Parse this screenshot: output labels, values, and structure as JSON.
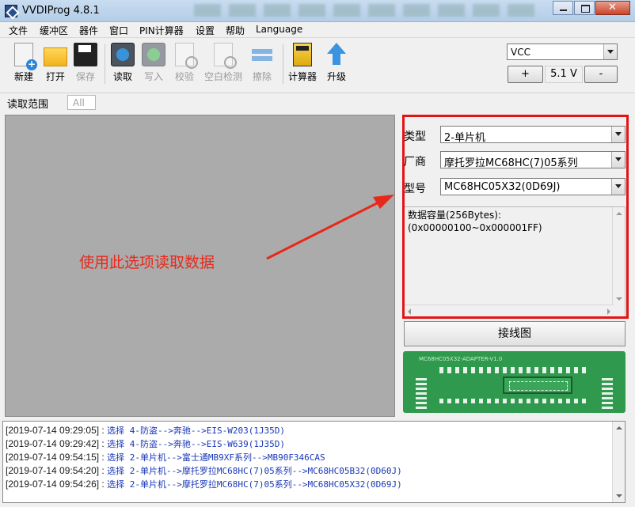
{
  "window": {
    "title": "VVDIProg 4.8.1"
  },
  "menu": [
    "文件",
    "缓冲区",
    "器件",
    "窗口",
    "PIN计算器",
    "设置",
    "帮助",
    "Language"
  ],
  "toolbar": {
    "new": "新建",
    "open": "打开",
    "save": "保存",
    "read": "读取",
    "write": "写入",
    "verify": "校验",
    "blank_check": "空白检测",
    "erase": "擦除",
    "calculator": "计算器",
    "upgrade": "升级"
  },
  "vcc": {
    "selected": "VCC",
    "plus": "+",
    "value": "5.1 V",
    "minus": "-"
  },
  "range": {
    "label": "读取范围",
    "value": "All"
  },
  "annotation": "使用此选项读取数据",
  "device": {
    "type_label": "类型",
    "type_value": "2-单片机",
    "vendor_label": "厂商",
    "vendor_value": "摩托罗拉MC68HC(7)05系列",
    "model_label": "型号",
    "model_value": "MC68HC05X32(0D69J)",
    "info": "数据容量(256Bytes):\n(0x00000100~0x000001FF)"
  },
  "wiring_button": "接线图",
  "board_label": "MC68HC05X32-ADAPTER-V1.0",
  "log": [
    {
      "ts": "[2019-07-14 09:29:05] : ",
      "msg": "选择 4-防盗-->奔驰-->EIS-W203(1J35D)"
    },
    {
      "ts": "[2019-07-14 09:29:42] : ",
      "msg": "选择 4-防盗-->奔驰-->EIS-W639(1J35D)"
    },
    {
      "ts": "[2019-07-14 09:54:15] : ",
      "msg": "选择 2-单片机-->富士通MB9XF系列-->MB90F346CAS"
    },
    {
      "ts": "[2019-07-14 09:54:20] : ",
      "msg": "选择 2-单片机-->摩托罗拉MC68HC(7)05系列-->MC68HC05B32(0D60J)"
    },
    {
      "ts": "[2019-07-14 09:54:26] : ",
      "msg": "选择 2-单片机-->摩托罗拉MC68HC(7)05系列-->MC68HC05X32(0D69J)"
    }
  ],
  "colors": {
    "annotation": "#e8281a",
    "highlight_box": "#e21414",
    "log_message": "#1a37b8"
  }
}
